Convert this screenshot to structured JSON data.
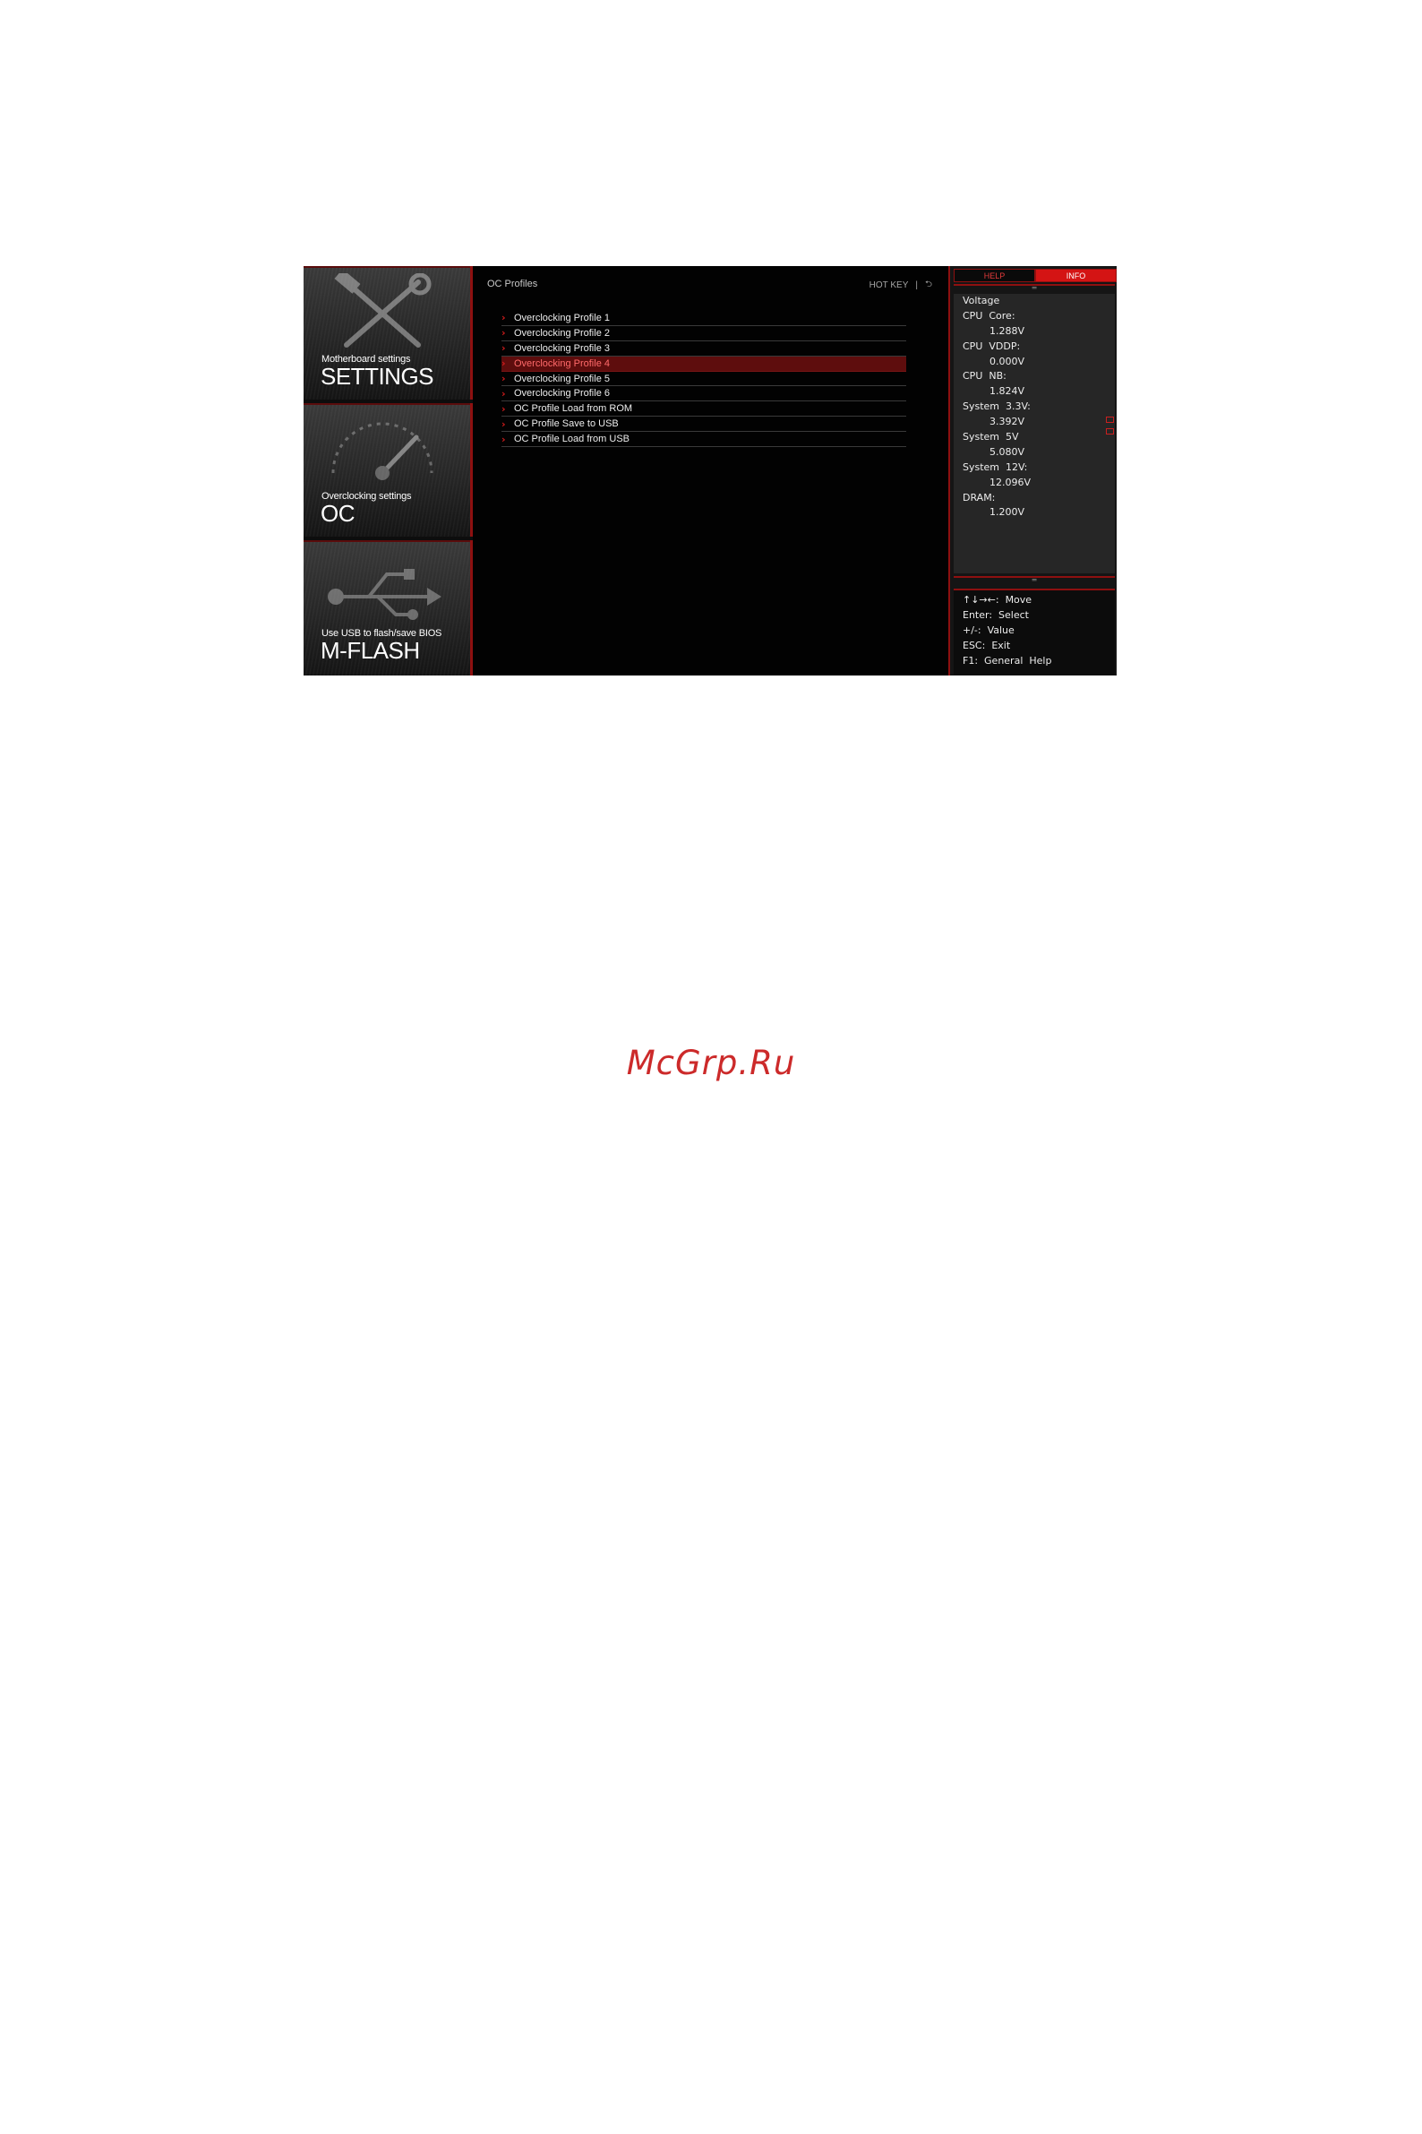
{
  "left_panel": {
    "tiles": [
      {
        "subtitle": "Motherboard settings",
        "title": "SETTINGS",
        "icon": "tools-icon"
      },
      {
        "subtitle": "Overclocking settings",
        "title": "OC",
        "icon": "gauge-icon"
      },
      {
        "subtitle": "Use USB to flash/save BIOS",
        "title": "M-FLASH",
        "icon": "usb-icon"
      }
    ]
  },
  "main": {
    "title": "OC Profiles",
    "hotkey_label": "HOT KEY",
    "hotkey_separator": "|",
    "back_icon": "back-arrow-icon",
    "menu_items": [
      {
        "label": "Overclocking Profile 1"
      },
      {
        "label": "Overclocking Profile 2"
      },
      {
        "label": "Overclocking Profile 3"
      },
      {
        "label": "Overclocking Profile 4",
        "selected": true
      },
      {
        "label": "Overclocking Profile 5"
      },
      {
        "label": "Overclocking Profile 6"
      },
      {
        "label": "OC Profile Load from ROM"
      },
      {
        "label": "OC Profile Save to USB"
      },
      {
        "label": "OC Profile Load from USB"
      }
    ]
  },
  "right_panel": {
    "tabs": {
      "help": "HELP",
      "info": "INFO",
      "active": "INFO"
    },
    "voltage": {
      "heading": "Voltage",
      "rows": [
        {
          "label": "CPU  Core:",
          "value": "1.288V"
        },
        {
          "label": "CPU  VDDP:",
          "value": "0.000V"
        },
        {
          "label": "CPU  NB:",
          "value": "1.824V"
        },
        {
          "label": "System  3.3V:",
          "value": "3.392V"
        },
        {
          "label": "System  5V",
          "value": "5.080V"
        },
        {
          "label": "System  12V:",
          "value": "12.096V"
        },
        {
          "label": "DRAM:",
          "value": "1.200V"
        }
      ]
    },
    "keys": [
      "↑↓→←:  Move",
      "Enter:  Select",
      "+/-:  Value",
      "ESC:  Exit",
      "F1:  General  Help"
    ]
  },
  "watermark": "McGrp.Ru",
  "colors": {
    "accent": "#d41414",
    "dark_red": "#5e0d0d",
    "background": "#000000",
    "watermark": "#cc2a2a"
  }
}
